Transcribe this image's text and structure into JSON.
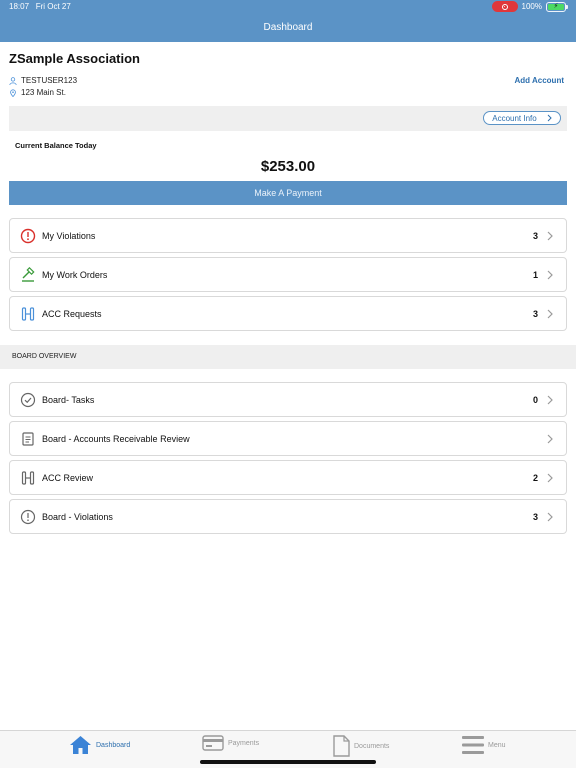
{
  "status_bar": {
    "time": "18:07",
    "date": "Fri Oct 27",
    "battery": "100%"
  },
  "nav": {
    "title": "Dashboard"
  },
  "association": {
    "name": "ZSample Association",
    "user": "TESTUSER123",
    "address": "123 Main St.",
    "add_account": "Add Account",
    "account_info": "Account Info"
  },
  "balance": {
    "label": "Current Balance Today",
    "amount": "$253.00",
    "pay_button": "Make A Payment"
  },
  "my_items": [
    {
      "label": "My Violations",
      "count": "3",
      "icon": "alert-circle-icon"
    },
    {
      "label": "My Work Orders",
      "count": "1",
      "icon": "gavel-icon"
    },
    {
      "label": "ACC Requests",
      "count": "3",
      "icon": "door-icon"
    }
  ],
  "board": {
    "header": "BOARD OVERVIEW",
    "items": [
      {
        "label": "Board- Tasks",
        "count": "0",
        "icon": "check-circle-icon"
      },
      {
        "label": "Board - Accounts Receivable Review",
        "count": "",
        "icon": "ledger-icon"
      },
      {
        "label": "ACC Review",
        "count": "2",
        "icon": "door-icon"
      },
      {
        "label": "Board - Violations",
        "count": "3",
        "icon": "alert-circle-icon"
      }
    ]
  },
  "tabs": [
    {
      "label": "Dashboard",
      "icon": "home-icon",
      "active": true
    },
    {
      "label": "Payments",
      "icon": "card-icon",
      "active": false
    },
    {
      "label": "Documents",
      "icon": "document-icon",
      "active": false
    },
    {
      "label": "Menu",
      "icon": "menu-icon",
      "active": false
    }
  ],
  "colors": {
    "primary": "#5b93c6",
    "link": "#2d6fae",
    "alert": "#d9302b",
    "work_order": "#3a9a3a",
    "acc": "#4a90d9"
  }
}
